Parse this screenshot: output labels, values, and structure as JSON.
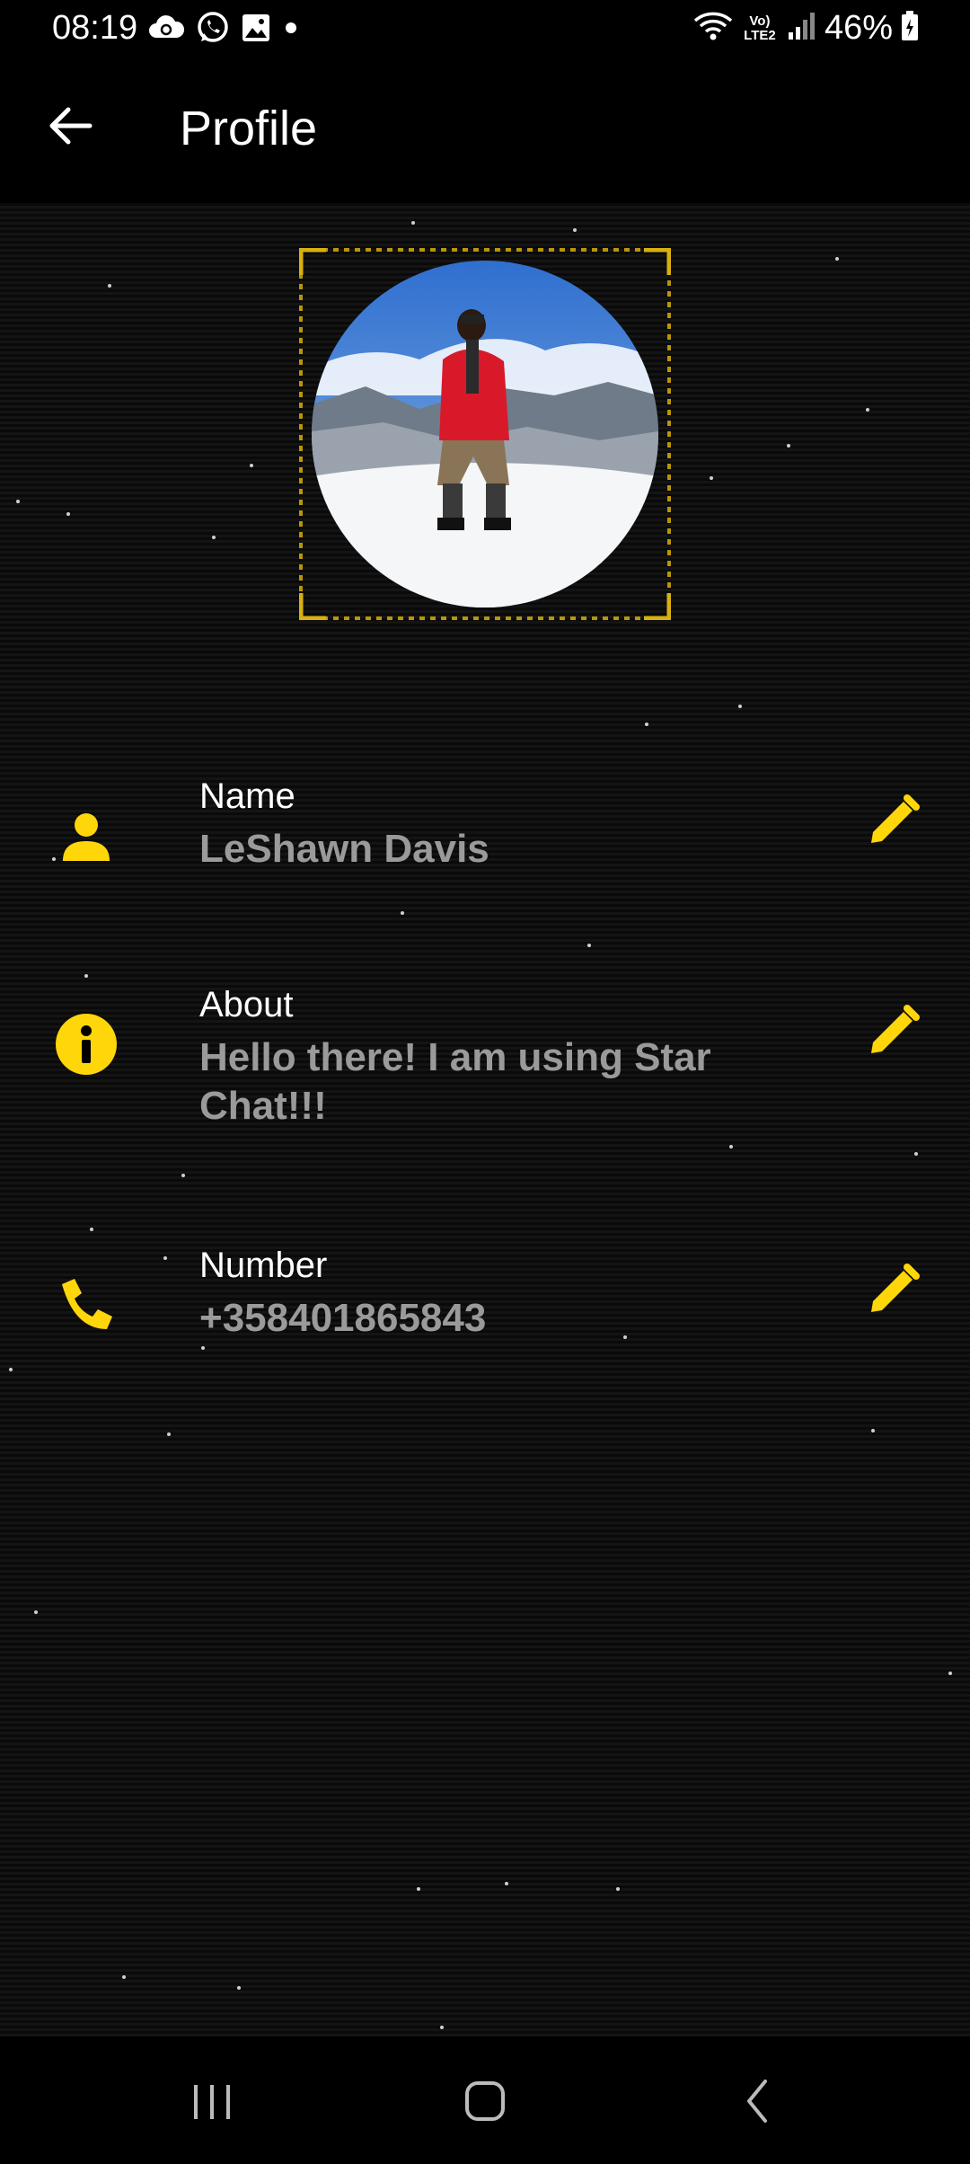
{
  "status_bar": {
    "time": "08:19",
    "network": "Vo) LTE2",
    "battery": "46%",
    "icons_left": [
      "cloud-sync-icon",
      "whatsapp-icon",
      "image-icon",
      "dot-icon"
    ],
    "icons_right": [
      "wifi-icon",
      "lte-icon",
      "signal-icon",
      "battery-icon"
    ]
  },
  "app_bar": {
    "title": "Profile",
    "back_icon": "arrow-left-icon"
  },
  "profile": {
    "fields": [
      {
        "label": "Name",
        "value": "LeShawn Davis",
        "icon": "person-icon"
      },
      {
        "label": "About",
        "value": "Hello there! I am using Star Chat!!!",
        "icon": "info-icon"
      },
      {
        "label": "Number",
        "value": "+358401865843",
        "icon": "phone-icon"
      }
    ]
  },
  "nav_bar": {
    "buttons": [
      "recents-icon",
      "home-icon",
      "back-icon"
    ]
  },
  "colors": {
    "accent": "#FFD60A",
    "background": "#000000",
    "value_text": "#9A9A9A"
  }
}
